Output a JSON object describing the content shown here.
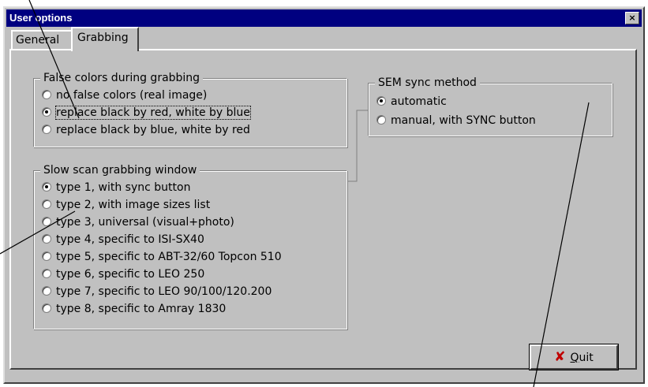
{
  "window": {
    "title": "User options",
    "close_glyph": "×"
  },
  "tabs": [
    {
      "label": "General"
    },
    {
      "label": "Grabbing"
    }
  ],
  "active_tab": "Grabbing",
  "false_colors": {
    "title": "False colors during grabbing",
    "options": [
      {
        "label": "no false colors (real image)",
        "selected": false
      },
      {
        "label": "replace black by red, white by blue",
        "selected": true
      },
      {
        "label": "replace black by blue, white by red",
        "selected": false
      }
    ]
  },
  "slow_scan": {
    "title": "Slow scan grabbing window",
    "options": [
      {
        "label": "type 1, with sync button",
        "selected": true
      },
      {
        "label": "type 2, with image sizes list",
        "selected": false
      },
      {
        "label": "type 3, universal (visual+photo)",
        "selected": false
      },
      {
        "label": "type 4, specific to ISI-SX40",
        "selected": false
      },
      {
        "label": "type 5, specific to ABT-32/60 Topcon 510",
        "selected": false
      },
      {
        "label": "type 6, specific to LEO 250",
        "selected": false
      },
      {
        "label": "type 7, specific to LEO 90/100/120.200",
        "selected": false
      },
      {
        "label": "type 8, specific to Amray 1830",
        "selected": false
      }
    ]
  },
  "sem_sync": {
    "title": "SEM sync method",
    "options": [
      {
        "label": "automatic",
        "selected": true
      },
      {
        "label": "manual, with SYNC button",
        "selected": false
      }
    ]
  },
  "quit_button": {
    "label": "Quit",
    "icon": "x-icon",
    "icon_color": "#c00000"
  },
  "colors": {
    "face": "#c0c0c0",
    "titlebar": "#000080"
  }
}
